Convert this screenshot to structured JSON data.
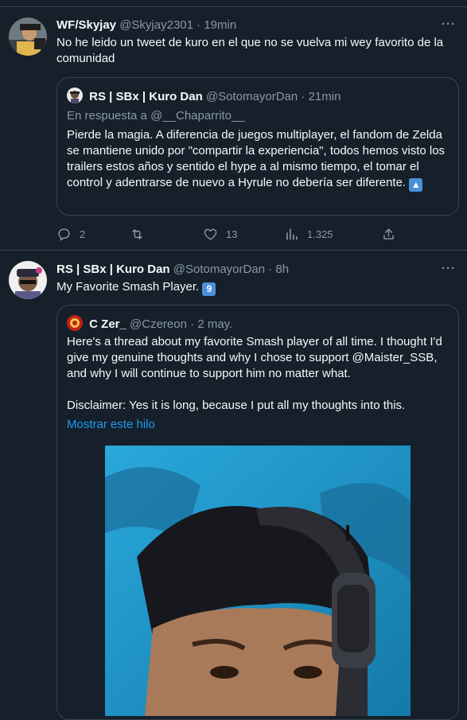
{
  "tweet1": {
    "name": "WF/Skyjay",
    "handle": "@Skyjay2301",
    "dot": "·",
    "time": "19min",
    "more": "···",
    "text": "No he leido un tweet de kuro en el que no se vuelva mi wey favorito de la comunidad",
    "quote": {
      "name": "RS | SBx | Kuro Dan",
      "handle": "@SotomayorDan",
      "dot": "·",
      "time": "21min",
      "reply_prefix": "En respuesta a ",
      "reply_handle": "@__Chaparrito__",
      "text": "Pierde la magia. A diferencia de juegos multiplayer, el fandom de Zelda se mantiene unido por \"compartir la experiencia\", todos hemos visto los trailers estos años y sentido el hype a al mismo tiempo, el tomar el control y adentrarse de nuevo a Hyrule no debería ser diferente.",
      "emoji": "▲"
    },
    "actions": {
      "replies": "2",
      "retweets": "",
      "likes": "13",
      "views": "1.325"
    }
  },
  "tweet2": {
    "name": "RS | SBx | Kuro Dan",
    "handle": "@SotomayorDan",
    "dot": "·",
    "time": "8h",
    "more": "···",
    "text": "My Favorite Smash Player.",
    "emoji": "9",
    "quote": {
      "name": "C Zer_",
      "handle": "@Czereon",
      "dot": "·",
      "time": "2 may.",
      "text1": "Here's a thread about my favorite Smash player of all time. I thought I'd give my genuine thoughts and why I chose to support @Maister_SSB, and why I will continue to support him no matter what.",
      "text2": "Disclaimer: Yes it is long, because I put all my thoughts into this.",
      "show_thread": "Mostrar este hilo"
    }
  },
  "colors": {
    "background": "#15202b",
    "border": "#38444d",
    "muted": "#8b98a5",
    "link": "#1d9bf0",
    "text": "#f7f9f9"
  }
}
